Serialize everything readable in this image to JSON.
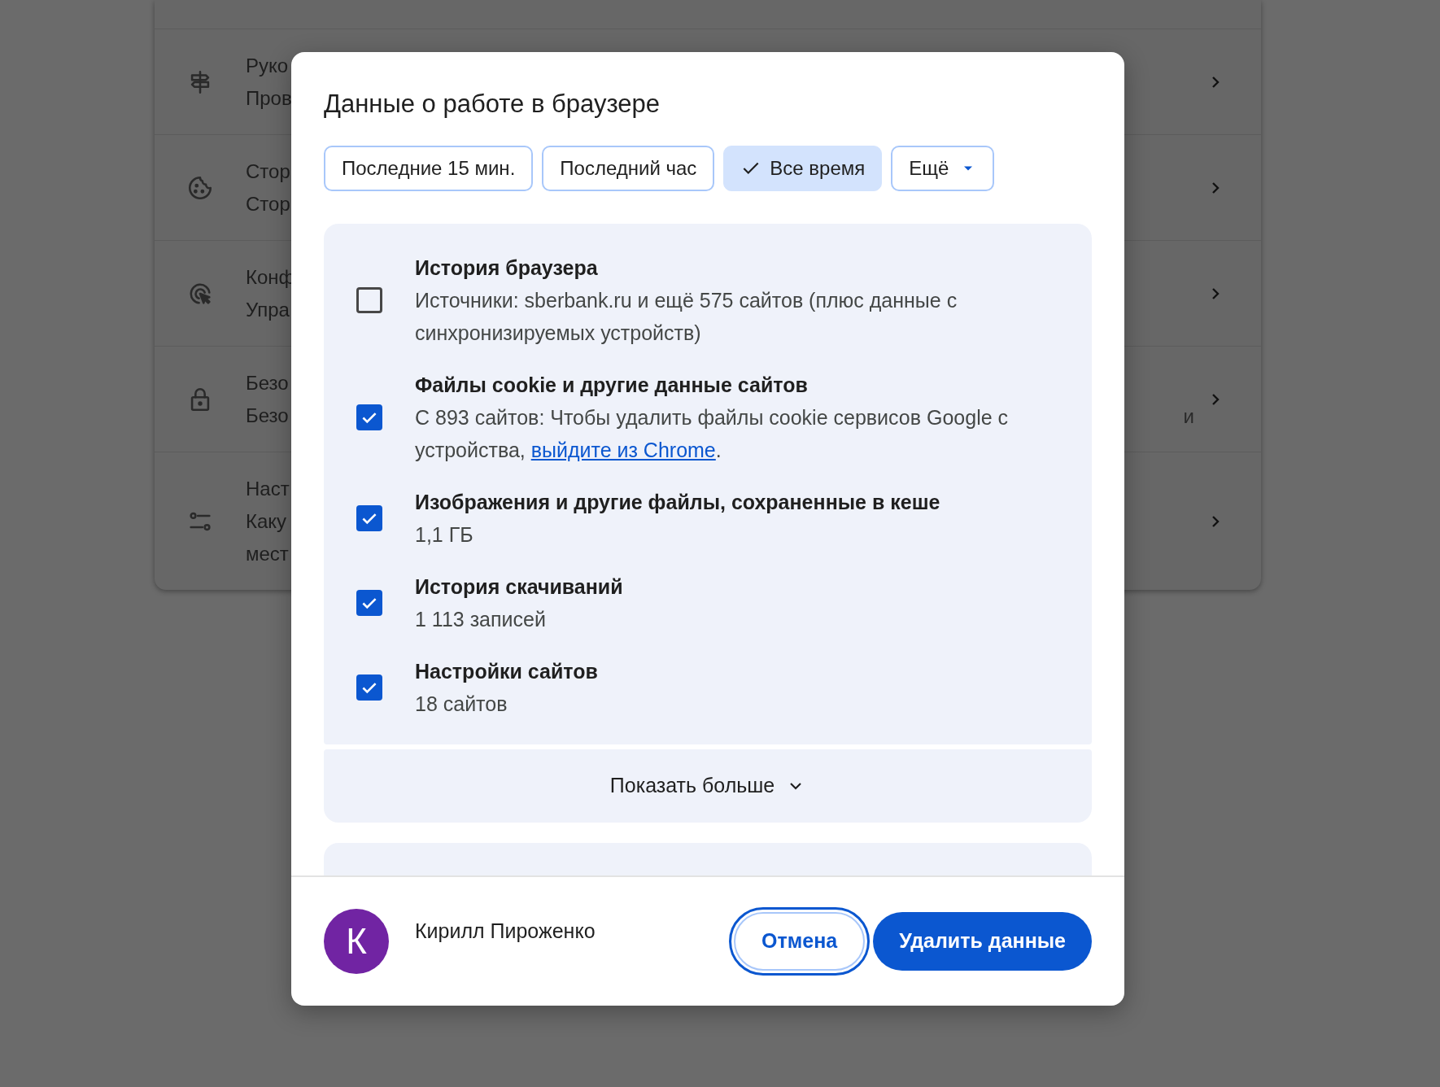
{
  "background_rows": [
    {
      "kind": "signpost",
      "lines": [
        "Руко",
        "Пров"
      ],
      "tail": ""
    },
    {
      "kind": "cookie",
      "lines": [
        "Стор",
        "Стор"
      ],
      "tail": ""
    },
    {
      "kind": "target",
      "lines": [
        "Конф",
        "Упра"
      ],
      "tail": ""
    },
    {
      "kind": "lock",
      "lines": [
        "Безо",
        "Безо"
      ],
      "tail": "и"
    },
    {
      "kind": "sliders",
      "lines": [
        "Наст",
        "Каку",
        "мест"
      ],
      "tail": ""
    }
  ],
  "dialog": {
    "title": "Данные о работе в браузере",
    "time_ranges": [
      {
        "label": "Последние 15 мин.",
        "selected": false,
        "kind": "chip"
      },
      {
        "label": "Последний час",
        "selected": false,
        "kind": "chip"
      },
      {
        "label": "Все время",
        "selected": true,
        "kind": "chip"
      },
      {
        "label": "Ещё",
        "selected": false,
        "kind": "dropdown"
      }
    ],
    "items": [
      {
        "title": "История браузера",
        "description": "Источники: sberbank.ru и ещё 575 сайтов (плюс данные с синхронизируемых устройств)",
        "checked": false
      },
      {
        "title": "Файлы cookie и другие данные сайтов",
        "description": "С 893 сайтов: Чтобы удалить файлы cookie сервисов Google с устройства, ",
        "link": "выйдите из Chrome",
        "description_end": ".",
        "checked": true
      },
      {
        "title": "Изображения и другие файлы, сохраненные в кеше",
        "description": "1,1 ГБ",
        "checked": true
      },
      {
        "title": "История скачиваний",
        "description": "1 113 записей",
        "checked": true
      },
      {
        "title": "Настройки сайтов",
        "description": "18 сайтов",
        "checked": true
      }
    ],
    "show_more": "Показать больше",
    "account": {
      "initial": "К",
      "name": "Кирилл Пироженко"
    },
    "buttons": [
      {
        "label": "Отмена",
        "kind": "secondary"
      },
      {
        "label": "Удалить данные",
        "kind": "primary"
      }
    ]
  }
}
